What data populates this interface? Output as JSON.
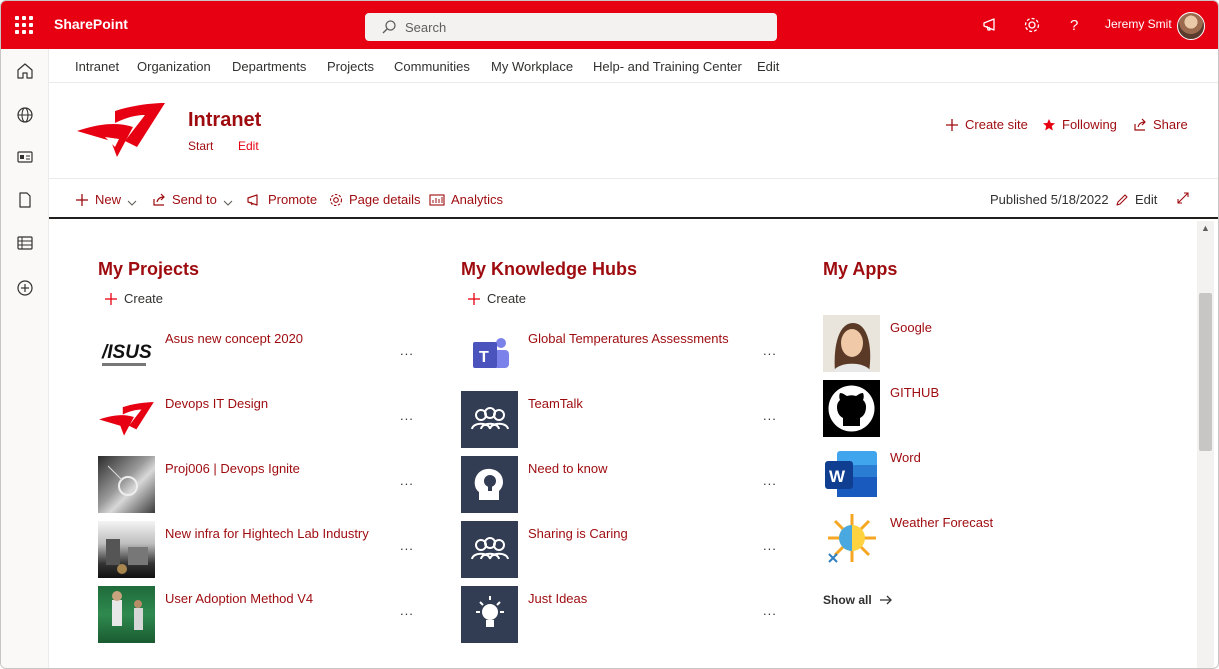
{
  "suitebar": {
    "app_name": "SharePoint",
    "search_placeholder": "Search",
    "user_name": "Jeremy Smit"
  },
  "hubnav": [
    "Intranet",
    "Organization",
    "Departments",
    "Projects",
    "Communities",
    "My Workplace",
    "Help- and Training Center",
    "Edit"
  ],
  "site": {
    "title": "Intranet",
    "links": [
      "Start",
      "Edit"
    ],
    "actions": {
      "create_site": "Create site",
      "following": "Following",
      "share": "Share"
    }
  },
  "commandbar": {
    "new": "New",
    "send_to": "Send to",
    "promote": "Promote",
    "page_details": "Page details",
    "analytics": "Analytics",
    "published": "Published 5/18/2022",
    "edit": "Edit"
  },
  "projects": {
    "title": "My Projects",
    "create": "Create",
    "items": [
      "Asus new concept 2020",
      "Devops IT Design",
      "Proj006 | Devops Ignite",
      "New infra for Hightech Lab Industry",
      "User Adoption Method V4"
    ],
    "more": "..."
  },
  "hubs": {
    "title": "My Knowledge Hubs",
    "create": "Create",
    "items": [
      "Global Temperatures Assessments",
      "TeamTalk",
      "Need to know",
      "Sharing is Caring",
      "Just Ideas"
    ],
    "more": "..."
  },
  "apps": {
    "title": "My Apps",
    "items": [
      "Google",
      "GITHUB",
      "Word",
      "Weather Forecast"
    ],
    "show_all": "Show all"
  },
  "colors": {
    "brand_red": "#e60012",
    "accent_dark_red": "#9e0b0f",
    "hub_tile_navy": "#323c52"
  }
}
